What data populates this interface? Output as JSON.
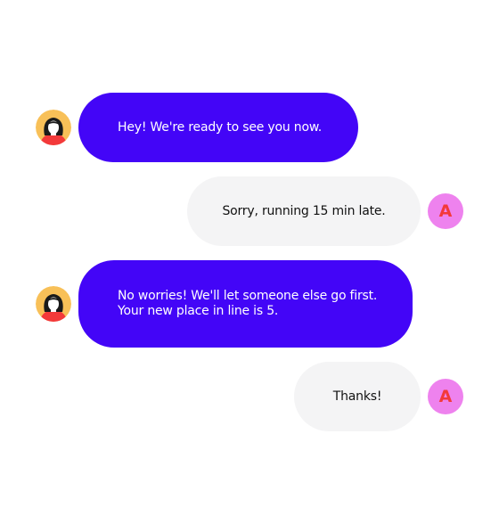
{
  "colors": {
    "agent_bubble": "#4305f7",
    "user_bubble": "#f4f4f5",
    "agent_avatar_bg": "#f8c058",
    "agent_avatar_shirt": "#f3393a",
    "agent_avatar_hair": "#1a1a1a",
    "agent_avatar_skin": "#ffffff",
    "user_avatar_bg": "#ee82ee",
    "user_avatar_letter": "#f3393a"
  },
  "messages": [
    {
      "sender": "agent",
      "avatar_icon": "woman-avatar-icon",
      "lines": [
        "Hey! We're ready to see you now."
      ]
    },
    {
      "sender": "user",
      "avatar_letter": "A",
      "lines": [
        "Sorry, running 15 min late."
      ]
    },
    {
      "sender": "agent",
      "avatar_icon": "woman-avatar-icon",
      "lines": [
        "No worries! We'll let someone else go first.",
        "Your new place in line is 5."
      ]
    },
    {
      "sender": "user",
      "avatar_letter": "A",
      "lines": [
        "Thanks!"
      ]
    }
  ]
}
